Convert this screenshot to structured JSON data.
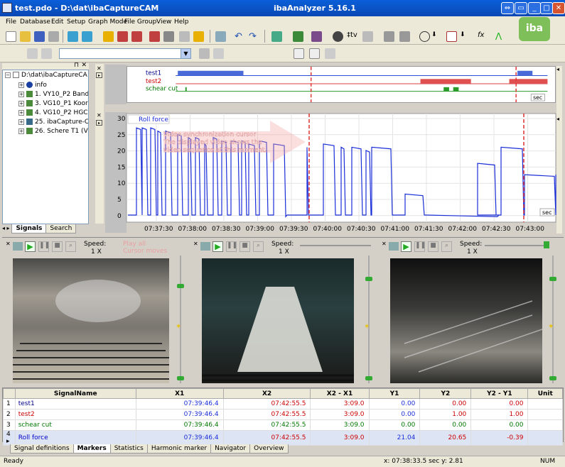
{
  "window": {
    "title": "test.pdo - D:\\dat\\ibaCaptureCAM",
    "app_title": "ibaAnalyzer 5.16.1"
  },
  "menu": [
    "File",
    "Database",
    "Edit",
    "Setup",
    "Graph Mode",
    "File Group",
    "View",
    "Help"
  ],
  "logo": "iba",
  "tree": {
    "root": "D:\\dat\\ibaCaptureCA",
    "items": [
      "info",
      "1. VY10_P2 Band",
      "3. VG10_P1 Koor",
      "4. VG10_P2 HGC",
      "25. ibaCapture-C",
      "26. Schere T1 (V"
    ]
  },
  "left_tabs": [
    "Signals",
    "Search"
  ],
  "digital_graph": {
    "signals": [
      "test1",
      "test2",
      "schear cut"
    ],
    "unit": "sec"
  },
  "analog_graph": {
    "signal": "Roll force",
    "unit": "sec",
    "y_ticks": [
      "30",
      "25",
      "20",
      "15",
      "10",
      "5",
      "0"
    ],
    "x_ticks": [
      "07:37:30",
      "07:38:00",
      "07:38:30",
      "07:39:00",
      "07:39:30",
      "07:40:00",
      "07:40:30",
      "07:41:00",
      "07:41:30",
      "07:42:00",
      "07:42:30",
      "07:43:00"
    ],
    "overlay": [
      "Video synchronization cursor",
      "The displayed video shows the",
      "video sequence at this moment."
    ]
  },
  "videos": [
    {
      "speed_label": "Speed:",
      "speed": "1 X",
      "overlay": [
        "Play all",
        "Cursor moves"
      ]
    },
    {
      "speed_label": "Speed:",
      "speed": "1 X"
    },
    {
      "speed_label": "Speed:",
      "speed": "1 X"
    }
  ],
  "table": {
    "headers": [
      "",
      "SignalName",
      "X1",
      "X2",
      "X2 - X1",
      "Y1",
      "Y2",
      "Y2 - Y1",
      "Unit"
    ],
    "rows": [
      {
        "n": "1",
        "name": "test1",
        "x1": "07:39:46.4",
        "x2": "07:42:55.5",
        "dx": "3:09.0",
        "y1": "0.00",
        "y2": "0.00",
        "dy": "0.00",
        "unit": "",
        "color": "#00008b"
      },
      {
        "n": "2",
        "name": "test2",
        "x1": "07:39:46.4",
        "x2": "07:42:55.5",
        "dx": "3:09.0",
        "y1": "0.00",
        "y2": "1.00",
        "dy": "1.00",
        "unit": "",
        "color": "#cc0000"
      },
      {
        "n": "3",
        "name": "schear cut",
        "x1": "07:39:46.4",
        "x2": "07:42:55.5",
        "dx": "3:09.0",
        "y1": "0.00",
        "y2": "0.00",
        "dy": "0.00",
        "unit": "",
        "color": "#007700"
      },
      {
        "n": "4 ▸",
        "name": "Roll force",
        "x1": "07:39:46.4",
        "x2": "07:42:55.5",
        "dx": "3:09.0",
        "y1": "21.04",
        "y2": "20.65",
        "dy": "-0.39",
        "unit": "",
        "color": "#0000cc"
      }
    ]
  },
  "bottom_tabs": [
    "Signal definitions",
    "Markers",
    "Statistics",
    "Harmonic marker",
    "Navigator",
    "Overview"
  ],
  "status": {
    "left": "Ready",
    "coords": "x: 07:38:33.5 sec  y: 2.81",
    "num": "NUM"
  }
}
